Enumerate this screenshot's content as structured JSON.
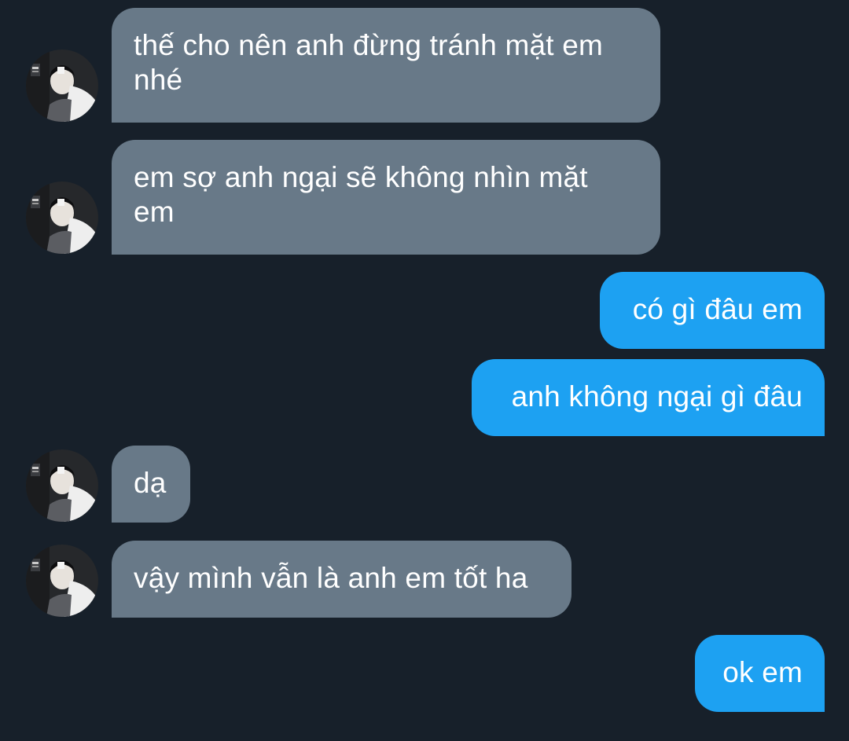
{
  "colors": {
    "background": "#17202a",
    "incoming_bubble": "#687988",
    "outgoing_bubble": "#1da1f2",
    "text": "#ffffff"
  },
  "messages": [
    {
      "direction": "incoming",
      "lines": [
        "thế cho nên anh đừng tránh mặt em",
        "nhé"
      ]
    },
    {
      "direction": "incoming",
      "lines": [
        "em sợ anh ngại sẽ không nhìn mặt",
        "em"
      ]
    },
    {
      "direction": "outgoing",
      "lines": [
        "có gì đâu em"
      ]
    },
    {
      "direction": "outgoing",
      "lines": [
        "anh không ngại gì đâu"
      ]
    },
    {
      "direction": "incoming",
      "lines": [
        "dạ"
      ]
    },
    {
      "direction": "incoming",
      "lines": [
        "vậy mình vẫn là anh em tốt ha"
      ]
    },
    {
      "direction": "outgoing",
      "lines": [
        "ok em"
      ]
    }
  ],
  "avatar_icon": "contact-avatar-photo"
}
